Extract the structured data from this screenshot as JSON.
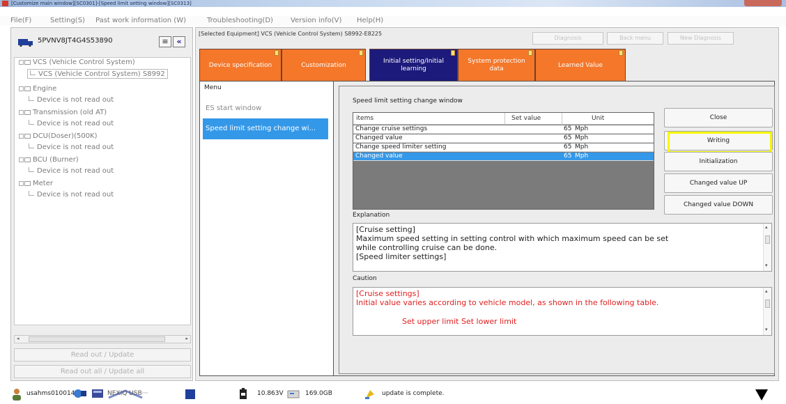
{
  "window": {
    "title": "[Customize main window][SC0301]-[Speed limit setting window][SC0313]"
  },
  "menu": {
    "file": "File(F)",
    "setting": "Setting(S)",
    "past_work": "Past work information (W)",
    "troubleshooting": "Troubleshooting(D)",
    "version": "Version info(V)",
    "help": "Help(H)"
  },
  "left": {
    "vin": "5PVNV8JT4G4S53890",
    "btn_menu": "≡",
    "btn_collapse": "«",
    "tree": [
      {
        "label": "VCS (Vehicle Control System)",
        "child": "VCS (Vehicle Control System) S8992"
      },
      {
        "label": "Engine",
        "child": "Device is not read out"
      },
      {
        "label": "Transmission (old AT)",
        "child": "Device is not read out"
      },
      {
        "label": "DCU(Doser)(500K)",
        "child": "Device is not read out"
      },
      {
        "label": "BCU (Burner)",
        "child": "Device is not read out"
      },
      {
        "label": "Meter",
        "child": "Device is not read out"
      }
    ],
    "read_out_update": "Read out / Update",
    "read_out_all": "Read out all / Update all"
  },
  "main": {
    "selected_equipment": "[Selected Equipment] VCS (Vehicle Control System) S8992-E8225",
    "btn_diagnosis": "Diagnosis",
    "btn_back_menu": "Back menu",
    "btn_new_diagnosis": "New Diagnosis",
    "tabs": [
      {
        "label": "Device specification"
      },
      {
        "label": "Customization"
      },
      {
        "label": "Initial setting/Initial learning"
      },
      {
        "label": "System protection data"
      },
      {
        "label": "Learned Value"
      }
    ],
    "menu_header": "Menu",
    "menu_items": [
      "ES start window",
      "Speed limit setting change wi..."
    ],
    "window_title": "Speed limit setting change window",
    "grid": {
      "headers": [
        "items",
        "Set value",
        "Unit"
      ],
      "rows": [
        {
          "item": "Change cruise settings",
          "value": "65",
          "unit": "Mph"
        },
        {
          "item": "Changed value",
          "value": "65",
          "unit": "Mph"
        },
        {
          "item": "Change speed limiter setting",
          "value": "65",
          "unit": "Mph"
        },
        {
          "item": "Changed value",
          "value": "65",
          "unit": "Mph"
        }
      ]
    },
    "buttons": {
      "close": "Close",
      "writing": "Writing",
      "initialization": "Initialization",
      "changed_up": "Changed value UP",
      "changed_down": "Changed value DOWN"
    },
    "explanation_label": "Explanation",
    "explanation_lines": [
      "[Cruise setting]",
      "Maximum speed setting in setting control with which maximum speed can be set",
      "while controlling cruise can be done.",
      "[Speed limiter settings]"
    ],
    "caution_label": "Caution",
    "caution_lines": [
      "[Cruise settings]",
      "Initial value varies according to vehicle model, as shown in the following table.",
      "Set upper limit  Set lower limit"
    ]
  },
  "status": {
    "user": "usahms010014",
    "adapter": "NEXIQ USB···",
    "voltage": "10.863V",
    "disk": "169.0GB",
    "message": "update is complete."
  },
  "colors": {
    "tab_orange": "#f4772a",
    "tab_active": "#1c1a7a",
    "selection_blue": "#3498e8",
    "highlight_yellow": "#f7f700",
    "caution_red": "#e02020"
  }
}
